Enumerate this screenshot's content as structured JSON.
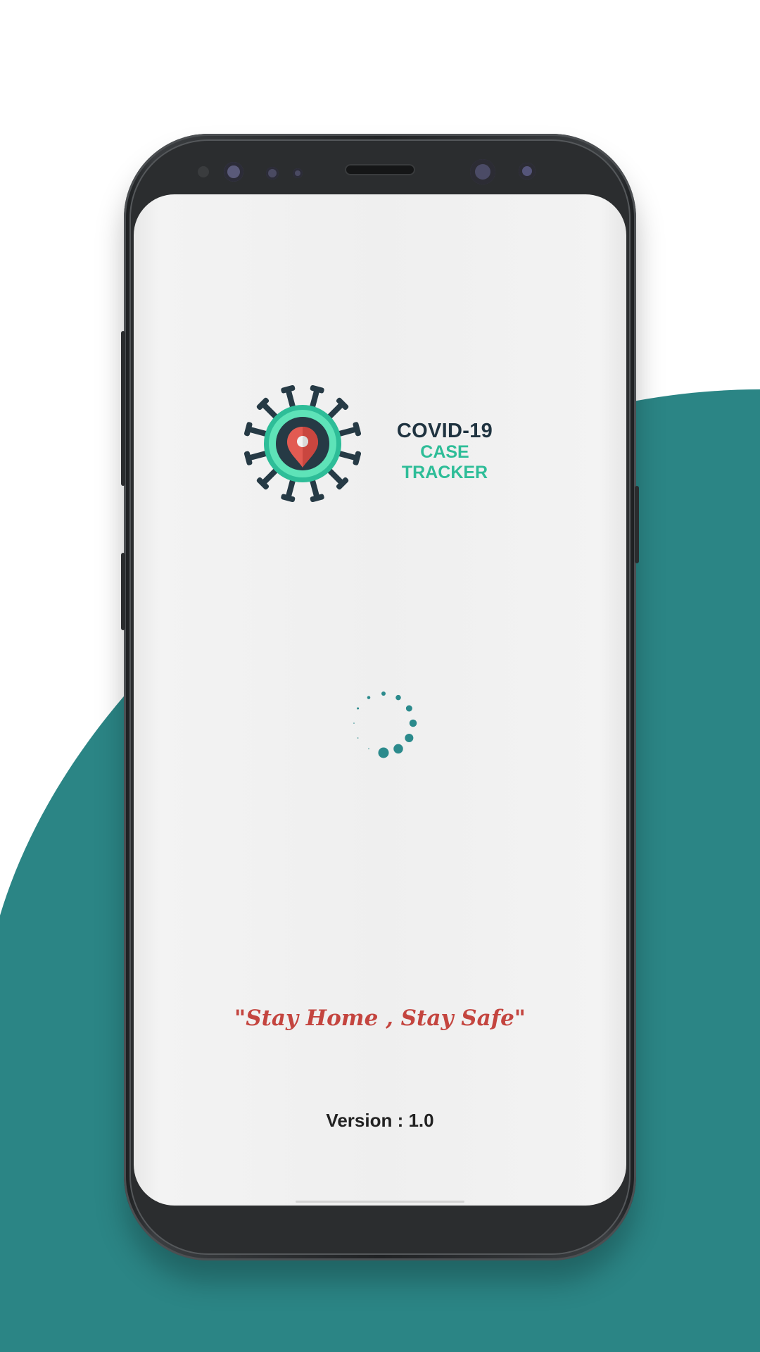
{
  "app": {
    "title": "COVID-19",
    "subtitle": "CASE TRACKER",
    "tagline": "\"Stay Home , Stay Safe\"",
    "version": "Version : 1.0"
  },
  "loading": {
    "state": "loading",
    "icon": "spinner-icon"
  },
  "icons": {
    "logo": "virus-location-pin-icon"
  },
  "colors": {
    "background_accent": "#2b8585",
    "title": "#1f3340",
    "subtitle": "#2ebd98",
    "tagline": "#c4453f",
    "spinner": "#2b8a8c",
    "virus_body": "#263a45",
    "pin": "#e25b52"
  }
}
